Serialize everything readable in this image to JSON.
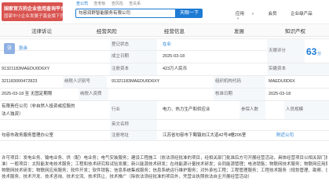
{
  "header": {
    "logo_line1": "国家官方的企业信用查询平台",
    "logo_line2": "国家中小企业发展子基金旗下官方网站",
    "search_tabs": [
      "查公司",
      "查老板",
      "查风险",
      "查关系"
    ],
    "search_value": "句容润舒智能服务有限公司",
    "search_button": "天眼一下",
    "nav": [
      "应用",
      "会员",
      "企业级产品"
    ]
  },
  "tabs": [
    {
      "label": "法律诉讼",
      "count": ""
    },
    {
      "label": "经营风险",
      "count": ""
    },
    {
      "label": "经营信息",
      "count": ""
    },
    {
      "label": "发展",
      "count": ""
    },
    {
      "label": "知识产权",
      "count": ""
    }
  ],
  "info": {
    "legal_rep_label": "",
    "avatar_char": "张",
    "legal_rep_name": "张余",
    "status_label": "登记状态",
    "status_value": "在业",
    "score_label": "天眼评分",
    "score_value": "63",
    "score_unit": "分",
    "founded_label": "成立日期",
    "founded_value": "2025-03-18",
    "uscc_value": "91321183MAEDU0D6XY",
    "reg_capital_label": "注册资本",
    "reg_capital_value": "423万人民币",
    "paid_capital_label": "实缴资本",
    "taxpayer_id_label": "纳税人识别号",
    "taxpayer_id_value": "91321183MAEDU0D6XY",
    "org_code_label": "组织机构代码",
    "org_code_value": "MAEDU0D6X",
    "reg_number": "321183000472823",
    "biz_term": "2025-03-18 至 无固定期限",
    "taxpayer_qual_label": "纳税人资质",
    "approval_date_label": "核准日期",
    "approval_date_value": "2025-03-18",
    "company_type_line1": "有限责任公司（非自然人投资或控股的",
    "company_type_line2": "法人独资）",
    "industry_label": "行业",
    "industry_value": "电力、热力生产和供应业",
    "insured_label": "参保人数",
    "staff_label": "人员规模",
    "english_name_label": "英文名称",
    "authority": "句容市政务服务管理办公室",
    "address_label": "注册地址",
    "address_value": "江苏省句容市下蜀镇向江大道42号4幢205室",
    "nearby": "附近公司",
    "scope": [
      "许可项目：发电业务、输电业务、供（配）电业务；电气安装服务；建设工程施工（依法须经批准的项目，经相关部门批准后方可开展经营活动，具体经营项目以相关部门批准文件或许可证件为",
      "准）一般项目：太阳能发电技术服务；工程和技术研究和试验发展；新兴能源技术研发；在线能源计量技术研发；合同能源管理；电池销售；物联网技术服务；物联网应用服务；储能技术服务；",
      "物联网技术研发；物联网应用服务；软件开发；软件销售；信息系统集成服务；信息系统运行维护服务；对外承包工程；工程管理服务；工程技术服务（规划管理、勘察、设计、监理除外）；",
      "技术服务、技术开发、技术咨询、技术交流、技术转让、技术推广（除依法须经批准的项目外，凭营业执照依法自主开展经营活动）"
    ]
  },
  "colors": {
    "accent": "#1e7bd4",
    "logo": "#d9534f",
    "label_bg": "#f5f8fb"
  }
}
